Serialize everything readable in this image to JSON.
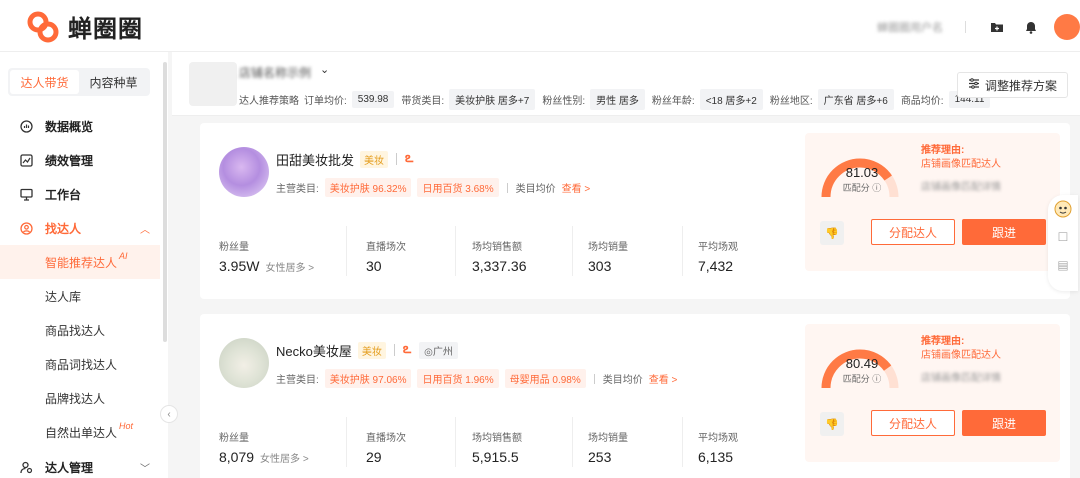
{
  "app": {
    "logo_text": "蝉圈圈",
    "brand_color": "#ff6a39"
  },
  "topbar": {
    "user_blurred": "蝉圈圈用户名"
  },
  "sidebar": {
    "segment": [
      "达人带货",
      "内容种草"
    ],
    "items": [
      {
        "label": "数据概览",
        "icon": "chart-icon"
      },
      {
        "label": "绩效管理",
        "icon": "trend-icon"
      },
      {
        "label": "工作台",
        "icon": "monitor-icon"
      },
      {
        "label": "找达人",
        "icon": "user-circle-icon"
      }
    ],
    "subitems": [
      {
        "label": "智能推荐达人",
        "badge": "AI"
      },
      {
        "label": "达人库"
      },
      {
        "label": "商品找达人"
      },
      {
        "label": "商品词找达人"
      },
      {
        "label": "品牌找达人"
      },
      {
        "label": "自然出单达人",
        "badge": "Hot"
      }
    ],
    "bottom_item": "达人管理"
  },
  "header": {
    "shop_name_blurred": "店铺名称示例",
    "strategy_label": "达人推荐策略",
    "filters": [
      {
        "label": "订单均价:",
        "value": "539.98"
      },
      {
        "label": "带货类目:",
        "value": "美妆护肤 居多+7"
      },
      {
        "label": "粉丝性别:",
        "value": "男性 居多"
      },
      {
        "label": "粉丝年龄:",
        "value": "<18 居多+2"
      },
      {
        "label": "粉丝地区:",
        "value": "广东省 居多+6"
      },
      {
        "label": "商品均价:",
        "value": "144.11"
      }
    ],
    "adjust_button": "调整推荐方案"
  },
  "cards": [
    {
      "name": "田甜美妆批发",
      "tag": "美妆",
      "location": "",
      "cats_label": "主营类目:",
      "cats": [
        "美妆护肤 96.32%",
        "日用百货 3.68%"
      ],
      "price_label": "类目均价",
      "view": "查看 >",
      "stats": [
        {
          "label": "粉丝量",
          "value": "3.95W",
          "extra": "女性居多 >"
        },
        {
          "label": "直播场次",
          "value": "30",
          "extra": ""
        },
        {
          "label": "场均销售额",
          "value": "3,337.36",
          "extra": ""
        },
        {
          "label": "场均销量",
          "value": "303",
          "extra": ""
        },
        {
          "label": "平均场观",
          "value": "7,432",
          "extra": ""
        }
      ],
      "score": "81.03",
      "score_fraction": 0.81,
      "score_label": "匹配分",
      "reason_title": "推荐理由:",
      "reason_text": "店铺画像匹配达人",
      "blur_text": "店铺画像匹配详情",
      "assign": "分配达人",
      "follow": "跟进"
    },
    {
      "name": "Necko美妆屋",
      "tag": "美妆",
      "location": "广州",
      "cats_label": "主营类目:",
      "cats": [
        "美妆护肤 97.06%",
        "日用百货 1.96%",
        "母婴用品 0.98%"
      ],
      "price_label": "类目均价",
      "view": "查看 >",
      "stats": [
        {
          "label": "粉丝量",
          "value": "8,079",
          "extra": "女性居多 >"
        },
        {
          "label": "直播场次",
          "value": "29",
          "extra": ""
        },
        {
          "label": "场均销售额",
          "value": "5,915.5",
          "extra": ""
        },
        {
          "label": "场均销量",
          "value": "253",
          "extra": ""
        },
        {
          "label": "平均场观",
          "value": "6,135",
          "extra": ""
        }
      ],
      "score": "80.49",
      "score_fraction": 0.8,
      "score_label": "匹配分",
      "reason_title": "推荐理由:",
      "reason_text": "店铺画像匹配达人",
      "blur_text": "店铺画像匹配详情",
      "assign": "分配达人",
      "follow": "跟进"
    }
  ]
}
